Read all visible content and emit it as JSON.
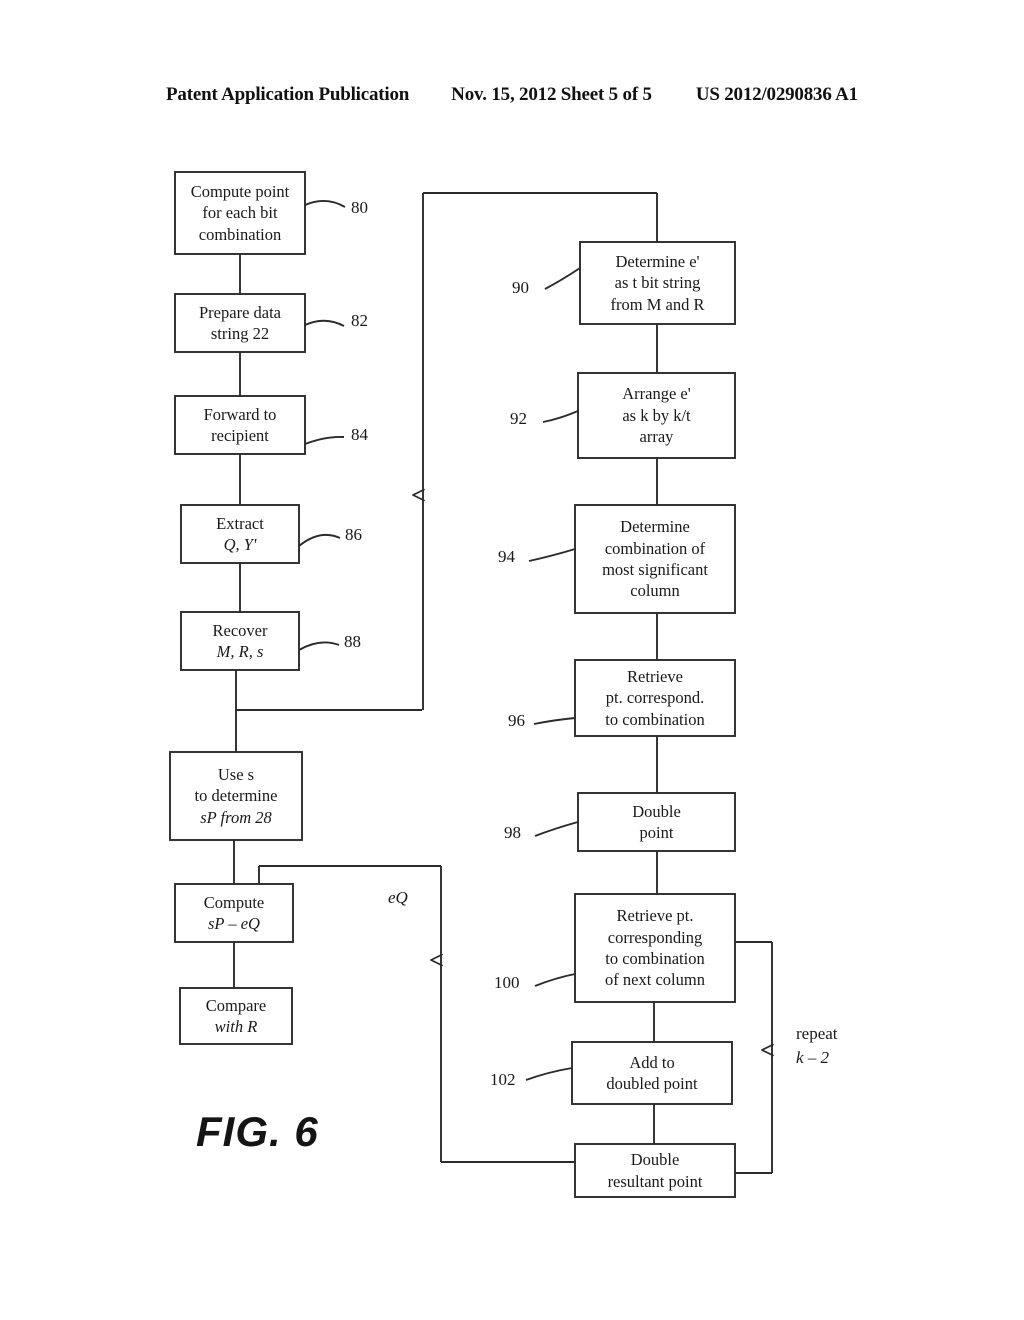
{
  "header": {
    "left": "Patent Application Publication",
    "middle": "Nov. 15, 2012   Sheet 5 of 5",
    "right": "US 2012/0290836 A1"
  },
  "figure": {
    "caption": "FIG. 6",
    "type": "flowchart",
    "title": "Elliptic curve signature verification flow"
  },
  "nodes": {
    "n80": {
      "ref": "80",
      "lines": [
        "Compute point",
        "for each bit",
        "combination"
      ]
    },
    "n82": {
      "ref": "82",
      "lines": [
        "Prepare data",
        "string 22"
      ]
    },
    "n84": {
      "ref": "84",
      "lines": [
        "Forward to",
        "recipient"
      ]
    },
    "n86": {
      "ref": "86",
      "lines": [
        "Extract",
        "Q, Y'"
      ]
    },
    "n88": {
      "ref": "88",
      "lines": [
        "Recover",
        "M, R, s"
      ]
    },
    "n_use_s": {
      "ref": "",
      "lines": [
        "Use s",
        "to determine",
        "sP from 28"
      ]
    },
    "n_compute": {
      "ref": "",
      "lines": [
        "Compute",
        "sP – eQ"
      ]
    },
    "n_compare": {
      "ref": "",
      "lines": [
        "Compare",
        "with R"
      ]
    },
    "n90": {
      "ref": "90",
      "lines": [
        "Determine e'",
        "as t bit string",
        "from M and R"
      ]
    },
    "n92": {
      "ref": "92",
      "lines": [
        "Arrange e'",
        "as k by k/t",
        "array"
      ]
    },
    "n94": {
      "ref": "94",
      "lines": [
        "Determine",
        "combination of",
        "most significant",
        "column"
      ]
    },
    "n96": {
      "ref": "96",
      "lines": [
        "Retrieve",
        "pt. correspond.",
        "to combination"
      ]
    },
    "n98": {
      "ref": "98",
      "lines": [
        "Double",
        "point"
      ]
    },
    "n100": {
      "ref": "100",
      "lines": [
        "Retrieve pt.",
        "corresponding",
        "to combination",
        "of next column"
      ]
    },
    "n102": {
      "ref": "102",
      "lines": [
        "Add to",
        "doubled point"
      ]
    },
    "n_double_res": {
      "ref": "",
      "lines": [
        "Double",
        "resultant point"
      ]
    }
  },
  "labels": {
    "eq": "eQ",
    "repeat_line1": "repeat",
    "repeat_line2": "k – 2"
  },
  "colors": {
    "ink": "#1a1a1a",
    "line": "#2b2b2b",
    "background": "#ffffff"
  }
}
